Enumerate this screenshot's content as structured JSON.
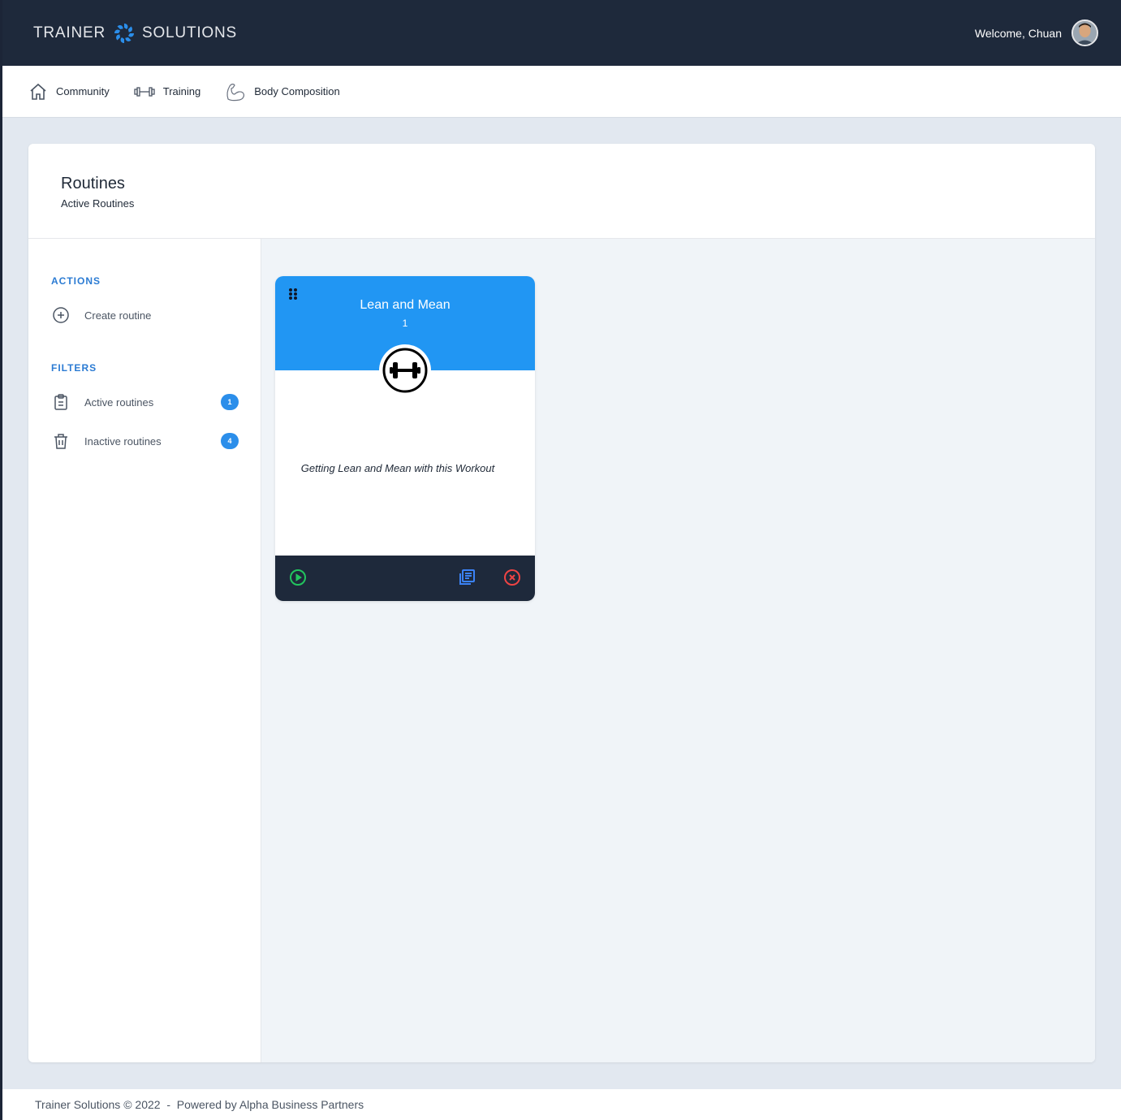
{
  "header": {
    "brand_left": "TRAINER",
    "brand_right": "SOLUTIONS",
    "welcome": "Welcome, Chuan"
  },
  "nav": [
    {
      "label": "Community",
      "icon": "home-icon"
    },
    {
      "label": "Training",
      "icon": "dumbbell-icon"
    },
    {
      "label": "Body Composition",
      "icon": "flexed-arm-icon"
    }
  ],
  "page": {
    "title": "Routines",
    "subtitle": "Active Routines"
  },
  "sidebar": {
    "actions_heading": "ACTIONS",
    "create_label": "Create routine",
    "filters_heading": "FILTERS",
    "filters": [
      {
        "label": "Active routines",
        "count": "1",
        "icon": "clipboard-icon"
      },
      {
        "label": "Inactive routines",
        "count": "4",
        "icon": "trash-icon"
      }
    ]
  },
  "routines": [
    {
      "name": "Lean and Mean",
      "count": "1",
      "description": "Getting Lean and Mean with this Workout",
      "icon": "dumbbell-icon"
    }
  ],
  "footer": {
    "text": "Trainer Solutions © 2022  -  Powered by Alpha Business Partners"
  },
  "colors": {
    "header_bg": "#1e293b",
    "accent": "#2196f3",
    "play": "#22c55e",
    "view": "#3b82f6",
    "delete": "#ef4444"
  }
}
